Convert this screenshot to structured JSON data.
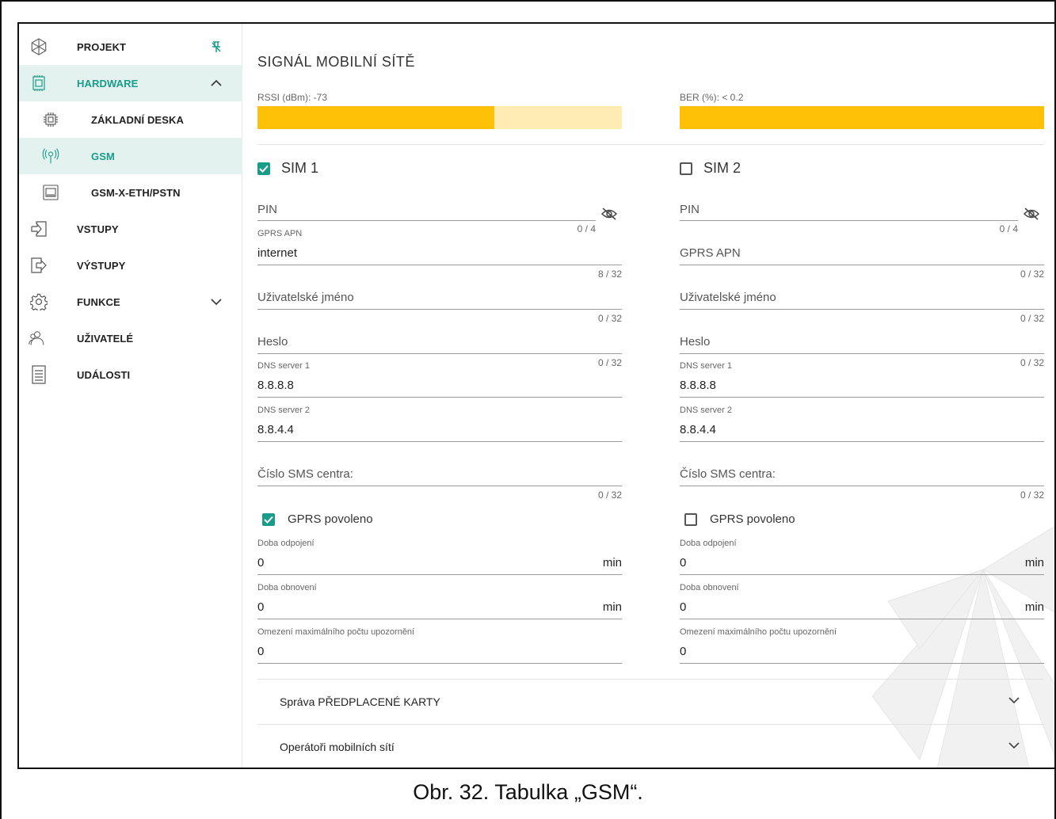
{
  "sidebar": {
    "items": [
      {
        "label": "PROJEKT",
        "icon": "project-icon"
      },
      {
        "label": "HARDWARE",
        "icon": "chip-icon"
      },
      {
        "label": "ZÁKLADNÍ DESKA",
        "icon": "chip-icon"
      },
      {
        "label": "GSM",
        "icon": "antenna-icon"
      },
      {
        "label": "GSM-X-ETH/PSTN",
        "icon": "module-icon"
      },
      {
        "label": "VSTUPY",
        "icon": "input-icon"
      },
      {
        "label": "VÝSTUPY",
        "icon": "output-icon"
      },
      {
        "label": "FUNKCE",
        "icon": "gear-icon"
      },
      {
        "label": "UŽIVATELÉ",
        "icon": "users-icon"
      },
      {
        "label": "UDÁLOSTI",
        "icon": "list-icon"
      }
    ]
  },
  "colors": {
    "accent": "#1a9c8a",
    "signal": "#ffc107",
    "signal_light": "#ffecb3",
    "active_bg": "#e3f2ef"
  },
  "signal": {
    "title": "SIGNÁL MOBILNÍ SÍTĚ",
    "rssi_label": "RSSI (dBm): -73",
    "rssi_fill": 0.65,
    "ber_label": "BER (%): < 0.2",
    "ber_fill": 1.0
  },
  "sim1": {
    "title": "SIM 1",
    "enabled": true,
    "pin": {
      "placeholder": "PIN",
      "count": "0 / 4"
    },
    "apn": {
      "label": "GPRS APN",
      "value": "internet",
      "count": "8 / 32"
    },
    "user": {
      "placeholder": "Uživatelské jméno",
      "count": "0 / 32"
    },
    "password": {
      "placeholder": "Heslo",
      "count": "0 / 32"
    },
    "dns1": {
      "label": "DNS server 1",
      "value": "8.8.8.8"
    },
    "dns2": {
      "label": "DNS server 2",
      "value": "8.8.4.4"
    },
    "sms": {
      "placeholder": "Číslo SMS centra:",
      "count": "0 / 32"
    },
    "gprs": {
      "label": "GPRS povoleno",
      "checked": true
    },
    "disconnect": {
      "label": "Doba odpojení",
      "value": "0",
      "unit": "min"
    },
    "renew": {
      "label": "Doba obnovení",
      "value": "0",
      "unit": "min"
    },
    "limit": {
      "label": "Omezení maximálního počtu upozornění",
      "value": "0"
    }
  },
  "sim2": {
    "title": "SIM 2",
    "enabled": false,
    "pin": {
      "placeholder": "PIN",
      "count": "0 / 4"
    },
    "apn": {
      "placeholder": "GPRS APN",
      "count": "0 / 32"
    },
    "user": {
      "placeholder": "Uživatelské jméno",
      "count": "0 / 32"
    },
    "password": {
      "placeholder": "Heslo",
      "count": "0 / 32"
    },
    "dns1": {
      "label": "DNS server 1",
      "value": "8.8.8.8"
    },
    "dns2": {
      "label": "DNS server 2",
      "value": "8.8.4.4"
    },
    "sms": {
      "placeholder": "Číslo SMS centra:",
      "count": "0 / 32"
    },
    "gprs": {
      "label": "GPRS povoleno",
      "checked": false
    },
    "disconnect": {
      "label": "Doba odpojení",
      "value": "0",
      "unit": "min"
    },
    "renew": {
      "label": "Doba obnovení",
      "value": "0",
      "unit": "min"
    },
    "limit": {
      "label": "Omezení maximálního počtu upozornění",
      "value": "0"
    }
  },
  "panels": {
    "prepaid": "Správa PŘEDPLACENÉ KARTY",
    "operators": "Operátoři mobilních sítí"
  },
  "caption": "Obr. 32. Tabulka „GSM“."
}
